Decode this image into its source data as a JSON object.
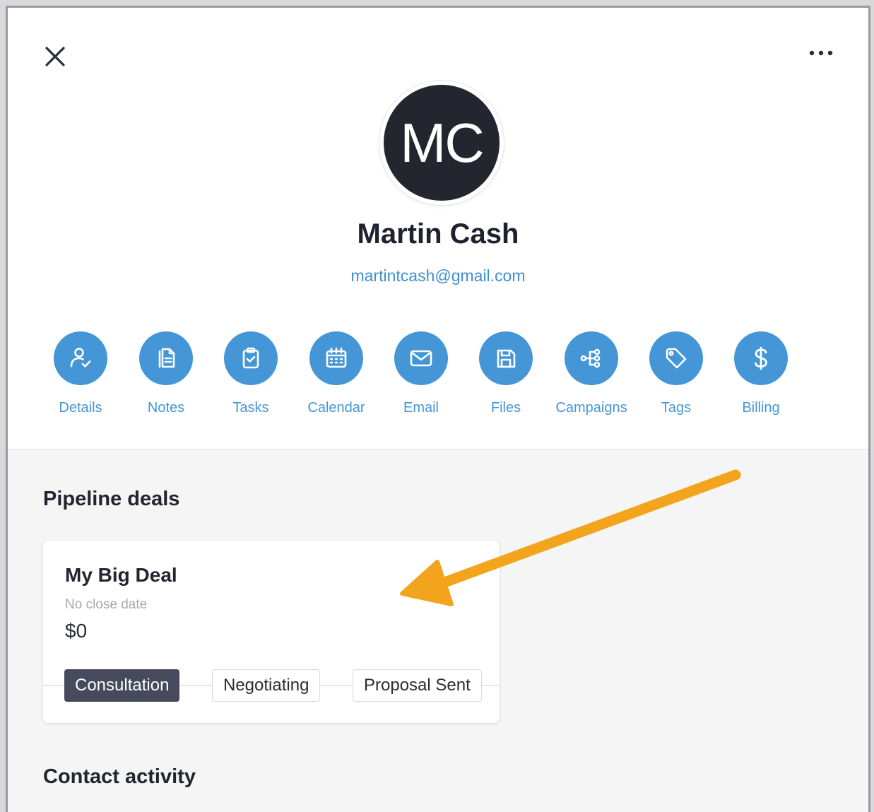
{
  "contact": {
    "initials": "MC",
    "name": "Martin Cash",
    "email": "martintcash@gmail.com"
  },
  "actions": [
    {
      "label": "Details",
      "icon": "user-check-icon"
    },
    {
      "label": "Notes",
      "icon": "notes-icon"
    },
    {
      "label": "Tasks",
      "icon": "clipboard-check-icon"
    },
    {
      "label": "Calendar",
      "icon": "calendar-icon"
    },
    {
      "label": "Email",
      "icon": "envelope-icon"
    },
    {
      "label": "Files",
      "icon": "floppy-disk-icon"
    },
    {
      "label": "Campaigns",
      "icon": "flow-tree-icon"
    },
    {
      "label": "Tags",
      "icon": "tag-icon"
    },
    {
      "label": "Billing",
      "icon": "dollar-icon"
    }
  ],
  "pipeline": {
    "title": "Pipeline deals",
    "deal": {
      "name": "My Big Deal",
      "close_date": "No close date",
      "amount": "$0",
      "stages": [
        "Consultation",
        "Negotiating",
        "Proposal Sent"
      ],
      "active_stage": "Consultation"
    }
  },
  "activity": {
    "title": "Contact activity"
  },
  "colors": {
    "accent": "#4596d6",
    "avatar_bg": "#23252f",
    "active_stage": "#464a5c",
    "annotation_arrow": "#f2a51c"
  }
}
